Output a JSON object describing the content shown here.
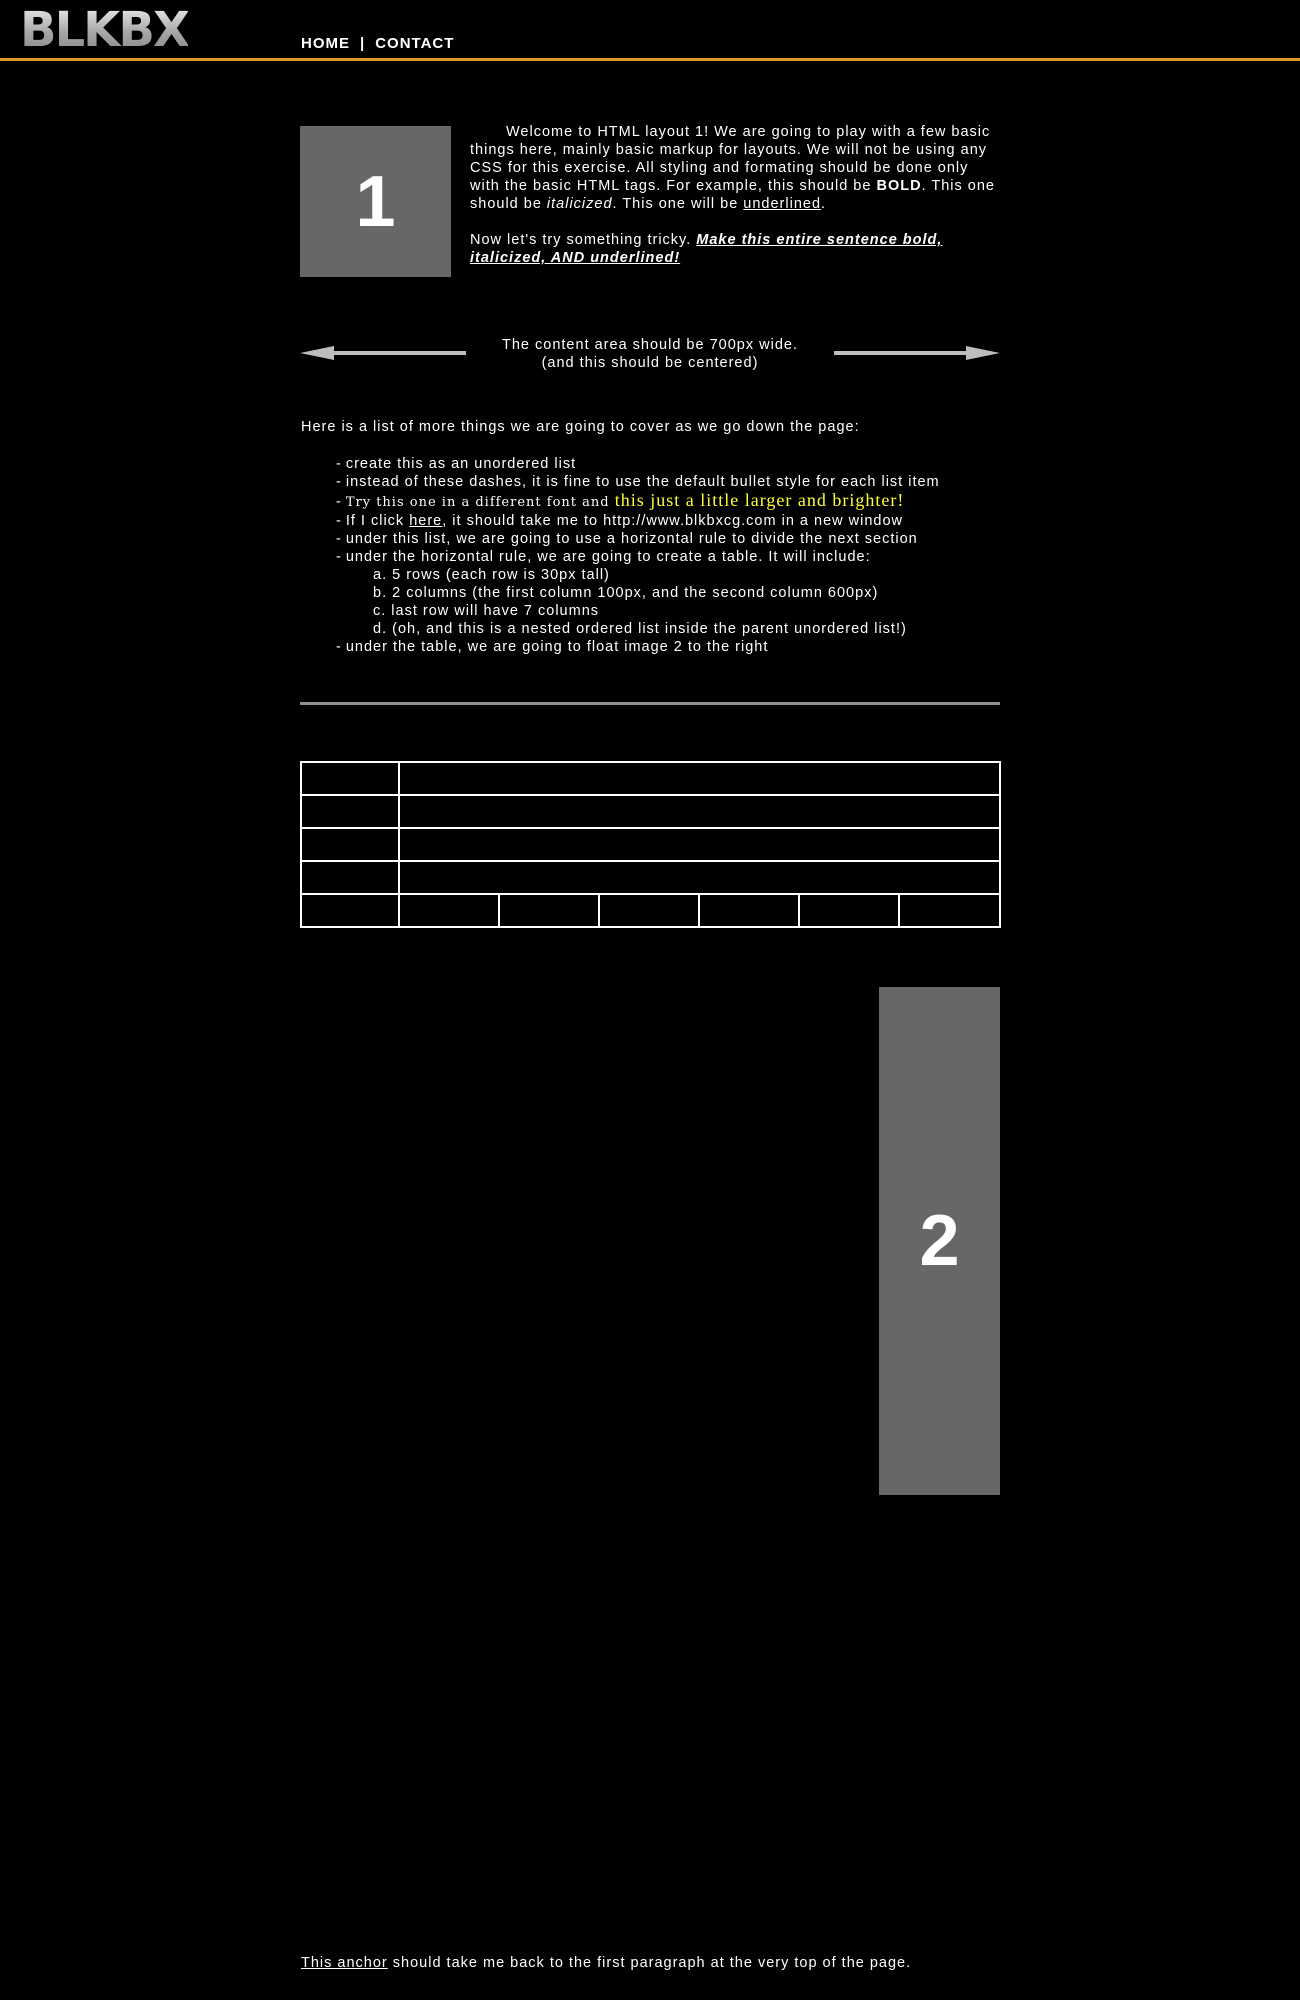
{
  "header": {
    "logo": "BLKBX",
    "nav": [
      {
        "label": "HOME"
      },
      {
        "label": "CONTACT"
      }
    ],
    "nav_separator": "|",
    "accent_color": "#e2972b"
  },
  "image1": {
    "label": "1"
  },
  "intro": {
    "para1_part1": "Welcome to HTML layout 1! We are going to play with a few basic things here, mainly basic markup for layouts. We will not be using any CSS for this exercise.  All styling and formating should be done only with the basic HTML tags. For example, this should be ",
    "bold": "BOLD",
    "part2": ". This one should be ",
    "italic": "italicized",
    "part3": ". This one will be ",
    "underlined": "underlined",
    "part4": ".",
    "para2_plain": "Now let's try something tricky. ",
    "para2_tricky": "Make this entire sentence bold, italicized, AND underlined! "
  },
  "centered": {
    "line1": "The content area should be 700px wide.",
    "line2": "(and this should be centered)"
  },
  "list": {
    "intro": "Here is a list of more things we are going to cover as we go down the page:",
    "dash": "-",
    "item1": "create this as an unordered list",
    "item2": "instead of these dashes, it is fine to use the default bullet style for each list item",
    "item3_small": "Try this one in a different font and ",
    "item3_big": "this just a little larger and brighter!",
    "item4_pre": "If I click ",
    "item4_link": "here",
    "item4_post": ", it should take me to http://www.blkbxcg.com in a new window",
    "item5": "under this list, we are going to use a horizontal rule to divide the next section",
    "item6": "under the horizontal rule, we are going to create a table. It will include:",
    "sub": [
      "a. 5 rows (each row is 30px tall)",
      "b. 2 columns (the first column 100px, and the second column 600px)",
      "c. last row will have 7 columns",
      "d. (oh, and this is a nested ordered list inside the parent unordered list!)"
    ],
    "item7": "under the table, we are going to float image 2 to the right"
  },
  "image2": {
    "label": "2"
  },
  "footer": {
    "anchor": "This anchor",
    "rest": " should take me back to the first paragraph at the very top of the page."
  }
}
